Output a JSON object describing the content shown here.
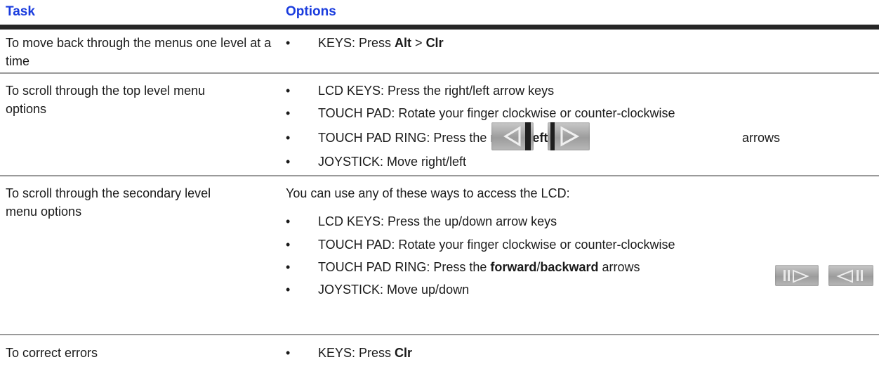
{
  "header": {
    "task": "Task",
    "options": "Options"
  },
  "rows": [
    {
      "task": "To move back through the menus one level at a time",
      "bullets": [
        {
          "parts": [
            "KEYS: Press ",
            "Alt",
            " > ",
            "Clr"
          ]
        }
      ]
    },
    {
      "task": "To scroll through the top level menu options",
      "bullets": [
        {
          "text": "LCD KEYS: Press the right/left arrow keys"
        },
        {
          "text": "TOUCH PAD: Rotate your finger clockwise or counter-clockwise"
        },
        {
          "parts": [
            "TOUCH PAD RING: Press the ",
            "right",
            " / ",
            "left",
            "arrows"
          ]
        },
        {
          "text": "JOYSTICK: Move right/left"
        }
      ]
    },
    {
      "task": "To scroll through the secondary level menu options",
      "intro": "You can use any of these ways to access the LCD:",
      "bullets": [
        {
          "text": "LCD KEYS: Press the up/down arrow keys"
        },
        {
          "text": "TOUCH PAD: Rotate your finger clockwise or counter-clockwise"
        },
        {
          "parts": [
            "TOUCH PAD RING: Press the ",
            "forward",
            "/",
            "backward",
            " arrows"
          ]
        },
        {
          "text": "JOYSTICK: Move up/down"
        }
      ]
    },
    {
      "task": "To correct errors",
      "bullets": [
        {
          "parts": [
            "KEYS: Press ",
            "Clr"
          ]
        }
      ]
    }
  ],
  "bullet_char": "•",
  "icons": {
    "left_arrow": "left-arrow-key-icon",
    "right_arrow": "right-arrow-key-icon",
    "forward": "forward-key-icon",
    "backward": "backward-key-icon"
  }
}
